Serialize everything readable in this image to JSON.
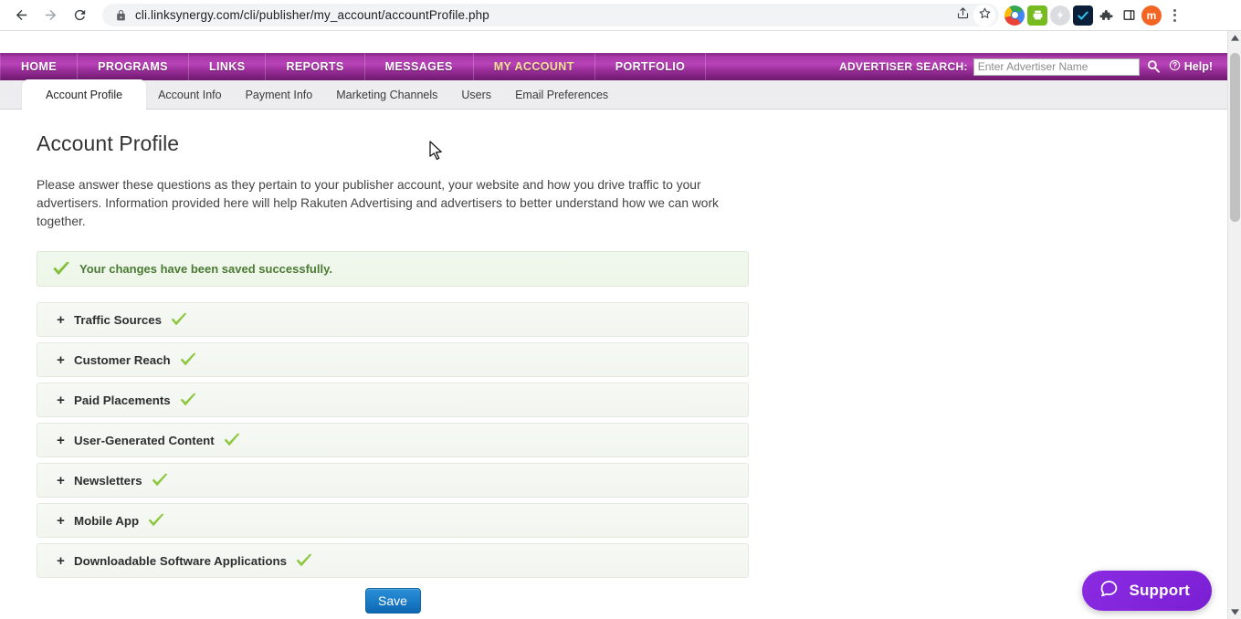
{
  "browser": {
    "back_icon": "back-arrow-icon",
    "forward_icon": "forward-arrow-icon",
    "reload_icon": "reload-icon",
    "lock_icon": "lock-icon",
    "url_scheme_host": "cli.linksynergy.com",
    "url_path": "/cli/publisher/my_account/accountProfile.php",
    "url_full": "cli.linksynergy.com/cli/publisher/my_account/accountProfile.php",
    "share_icon": "share-icon",
    "bookmark_icon": "star-icon",
    "extensions": [
      {
        "name": "chrome-extension-icon",
        "label": ""
      },
      {
        "name": "printer-extension-icon",
        "label": ""
      },
      {
        "name": "flash-extension-icon",
        "label": ""
      },
      {
        "name": "checkmark-extension-icon",
        "label": ""
      },
      {
        "name": "puzzle-extensions-icon",
        "label": ""
      },
      {
        "name": "sidepanel-icon",
        "label": ""
      }
    ],
    "avatar_initial": "m",
    "menu_icon": "kebab-menu-icon"
  },
  "site_nav": {
    "items": [
      {
        "label": "HOME",
        "active": false
      },
      {
        "label": "PROGRAMS",
        "active": false
      },
      {
        "label": "LINKS",
        "active": false
      },
      {
        "label": "REPORTS",
        "active": false
      },
      {
        "label": "MESSAGES",
        "active": false
      },
      {
        "label": "MY ACCOUNT",
        "active": true
      },
      {
        "label": "PORTFOLIO",
        "active": false
      }
    ],
    "search_label": "ADVERTISER SEARCH:",
    "search_placeholder": "Enter Advertiser Name",
    "search_value": "",
    "search_icon": "magnifier-icon",
    "help_label": "Help!",
    "help_icon": "question-circle-icon",
    "accent_color": "#a939a9",
    "active_color": "#fbe29a"
  },
  "subtabs": [
    {
      "label": "Account Profile",
      "active": true
    },
    {
      "label": "Account Info",
      "active": false
    },
    {
      "label": "Payment Info",
      "active": false
    },
    {
      "label": "Marketing Channels",
      "active": false
    },
    {
      "label": "Users",
      "active": false
    },
    {
      "label": "Email Preferences",
      "active": false
    }
  ],
  "page": {
    "title": "Account Profile",
    "intro": "Please answer these questions as they pertain to your publisher account, your website and how you drive traffic to your advertisers. Information provided here will help Rakuten Advertising and advertisers to better understand how we can work together."
  },
  "alert": {
    "icon": "green-check-icon",
    "text": "Your changes have been saved successfully.",
    "text_color": "#4b7a35",
    "bg_color": "#eef6e9"
  },
  "accordion": {
    "expander_glyph": "+",
    "check_icon": "green-check-icon",
    "sections": [
      {
        "label": "Traffic Sources",
        "completed": true
      },
      {
        "label": "Customer Reach",
        "completed": true
      },
      {
        "label": "Paid Placements",
        "completed": true
      },
      {
        "label": "User-Generated Content",
        "completed": true
      },
      {
        "label": "Newsletters",
        "completed": true
      },
      {
        "label": "Mobile App",
        "completed": true
      },
      {
        "label": "Downloadable Software Applications",
        "completed": true
      }
    ]
  },
  "save": {
    "label": "Save",
    "color": "#1d7fc9"
  },
  "support": {
    "label": "Support",
    "icon": "chat-bubble-icon",
    "color": "#7b2ff7"
  },
  "scrollbar": {
    "up_icon": "scroll-up-arrow-icon",
    "down_icon": "scroll-down-arrow-icon"
  }
}
